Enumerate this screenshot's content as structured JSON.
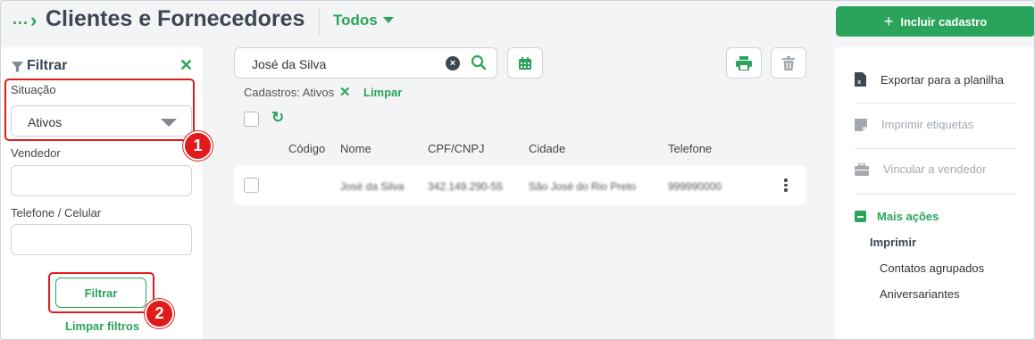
{
  "header": {
    "breadcrumb_dots": "...",
    "title": "Clientes e Fornecedores",
    "view_filter": "Todos",
    "add_button_label": "Incluir cadastro"
  },
  "filter": {
    "title": "Filtrar",
    "situacao_label": "Situação",
    "situacao_value": "Ativos",
    "vendedor_label": "Vendedor",
    "vendedor_value": "",
    "telefone_label": "Telefone / Celular",
    "telefone_value": "",
    "filter_button": "Filtrar",
    "clear_filters": "Limpar filtros"
  },
  "annotations": {
    "badge_1": "1",
    "badge_2": "2",
    "color": "#e01b1b"
  },
  "search": {
    "value": "José da Silva"
  },
  "active_filters": {
    "label": "Cadastros: Ativos",
    "clear": "Limpar"
  },
  "table": {
    "columns": [
      "Código",
      "Nome",
      "CPF/CNPJ",
      "Cidade",
      "Telefone"
    ],
    "rows": [
      {
        "codigo": "",
        "nome": "José da Silva",
        "cpf": "342.149.290-55",
        "cidade": "São José do Rio Preto",
        "telefone": "999990000"
      }
    ]
  },
  "actions": {
    "export": "Exportar para a planilha",
    "print_labels": "Imprimir etiquetas",
    "link_seller": "Vincular a vendedor",
    "more_actions": "Mais ações",
    "print_heading": "Imprimir",
    "grouped_contacts": "Contatos agrupados",
    "birthdays": "Aniversariantes"
  },
  "colors": {
    "accent": "#2aa45a",
    "title": "#3d4653",
    "disabled": "#a3a8ae"
  }
}
